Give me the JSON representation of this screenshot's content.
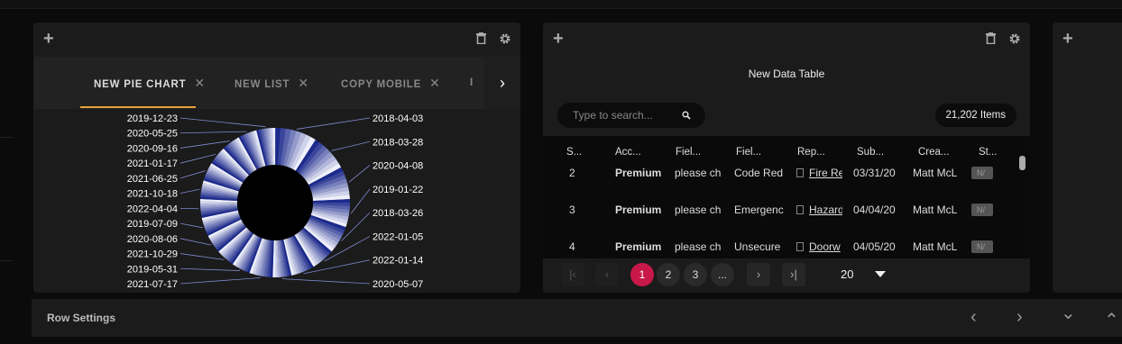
{
  "panels": {
    "pie_panel": {
      "add_label": "+",
      "tabs": [
        {
          "label": "NEW PIE CHART",
          "close": "✕",
          "active": true
        },
        {
          "label": "NEW LIST",
          "close": "✕",
          "active": false
        },
        {
          "label": "COPY MOBILE",
          "close": "✕",
          "active": false
        },
        {
          "label": "I",
          "close": "",
          "active": false
        }
      ],
      "tab_next": "›"
    },
    "table_panel": {
      "add_label": "+",
      "title": "New Data Table",
      "search_placeholder": "Type to search...",
      "item_count": "21,202 Items",
      "columns": [
        "S...",
        "Acc...",
        "Fiel...",
        "Fiel...",
        "Rep...",
        "Sub...",
        "Crea...",
        "St..."
      ],
      "rows": [
        {
          "num": "2",
          "account": "Premium",
          "field1": "please ch",
          "field2": "Code Red",
          "report": "Fire Re",
          "submitted": "03/31/20",
          "creator": "Matt McL",
          "status": "N/"
        },
        {
          "num": "3",
          "account": "Premium",
          "field1": "please ch",
          "field2": "Emergenc",
          "report": "Hazard",
          "submitted": "04/04/20",
          "creator": "Matt McL",
          "status": "N/"
        },
        {
          "num": "4",
          "account": "Premium",
          "field1": "please ch",
          "field2": "Unsecure",
          "report": "Doorw",
          "submitted": "04/05/20",
          "creator": "Matt McL",
          "status": "N/"
        }
      ],
      "pager": {
        "first": "|‹",
        "prev": "‹",
        "pages": [
          "1",
          "2",
          "3",
          "..."
        ],
        "active_page": "1",
        "next": "›",
        "last": "›|",
        "page_size": "20"
      }
    },
    "third_panel": {
      "add_label": "+"
    }
  },
  "row_settings": {
    "label": "Row Settings",
    "controls": [
      "‹",
      "›",
      "⌄",
      "⌃"
    ]
  },
  "colors": {
    "accent_tab": "#e8a13a",
    "active_page": "#c8184a",
    "pie_dark": "#1c2a8c",
    "pie_light": "#eef0fb"
  },
  "chart_data": {
    "type": "pie",
    "donut": true,
    "legend": "outside-labels",
    "labels": [
      "2018-04-03",
      "2018-03-28",
      "2020-04-08",
      "2019-01-22",
      "2018-03-26",
      "2022-01-05",
      "2022-01-14",
      "2020-05-07",
      "2021-07-17",
      "2019-05-31",
      "2021-10-29",
      "2020-08-06",
      "2019-07-09",
      "2022-04-04",
      "2021-10-18",
      "2021-06-25",
      "2021-01-17",
      "2020-09-16",
      "2020-05-25",
      "2019-12-23"
    ],
    "values": [
      9,
      8,
      7,
      6,
      6,
      5,
      5,
      4,
      5,
      4,
      4,
      4,
      4,
      4,
      4,
      4,
      4,
      4,
      4,
      4
    ]
  }
}
